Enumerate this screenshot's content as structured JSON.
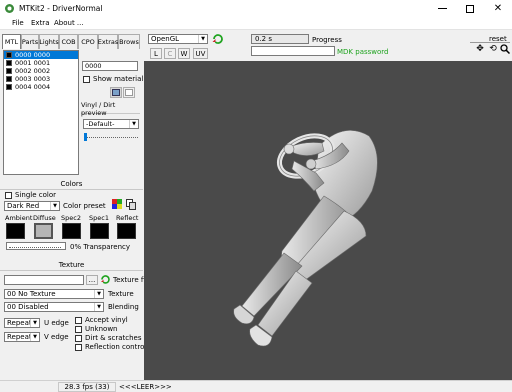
{
  "window": {
    "title": "MTKit2 - DriverNormal"
  },
  "menu": [
    {
      "label": "File"
    },
    {
      "label": "Extra"
    },
    {
      "label": "About ..."
    }
  ],
  "tabs": [
    "MTL",
    "Parts",
    "Lights",
    "COB",
    "CPO",
    "Extras",
    "Brows"
  ],
  "mtl_list": [
    "0000 0000",
    "0001 0001",
    "0002 0002",
    "0003 0003",
    "0004 0004"
  ],
  "mtl_panel": {
    "name_value": "0000",
    "show_material": "Show material"
  },
  "vinyl": {
    "header": "Vinyl / Dirt preview",
    "combo": "-Default-"
  },
  "colors": {
    "header": "Colors",
    "single_color": "Single color",
    "preset_value": "Dark Red",
    "preset_label": "Color preset",
    "ambient": "Ambient",
    "diffuse": "Diffuse",
    "spec2": "Spec2",
    "spec1": "Spec1",
    "reflect": "Reflect",
    "transparency": "0% Transparency"
  },
  "texture": {
    "header": "Texture",
    "file_button": "...",
    "file_label": "Texture file",
    "texture_value": "00 No Texture",
    "texture_label": "Texture",
    "blending_value": "00 Disabled",
    "blending_label": "Blending",
    "u_value": "Repeat",
    "u_label": "U edge",
    "v_value": "Repeat",
    "v_label": "V edge",
    "accept_vinyl": "Accept vinyl",
    "unknown": "Unknown",
    "dirt": "Dirt & scratches",
    "reflection": "Reflection control"
  },
  "viewport": {
    "renderer": "OpenGL",
    "buttons": [
      "L",
      "C",
      "W",
      "UV"
    ],
    "time_value": "0.2 s",
    "progress_label": "Progress",
    "password_label": "MDK password",
    "reset_label": "reset",
    "bg_color": "#4a4a4a",
    "accent_green": "#1fa31f"
  },
  "status": {
    "fps": "28.3 fps (33)",
    "text": "<<<LEER>>>"
  }
}
